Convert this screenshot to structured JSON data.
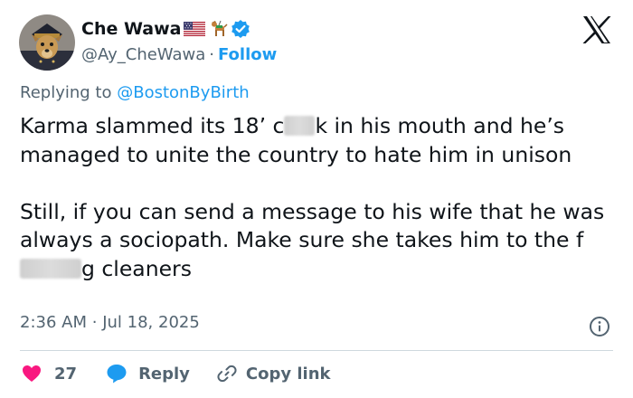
{
  "author": {
    "name": "Che Wawa",
    "handle": "@Ay_CheWawa",
    "separator": "·",
    "follow_label": "Follow",
    "emojis": [
      "us-flag-emoji",
      "guide-dog-emoji"
    ],
    "verified": true
  },
  "reply_context": {
    "prefix": "Replying to",
    "mention": "@BostonByBirth"
  },
  "tweet": {
    "paragraph1": {
      "part1": "Karma slammed its 18’ c",
      "part2": "k in his mouth and he’s managed to unite the country to hate him in unison"
    },
    "paragraph2": {
      "part1": "Still, if you can send a message to his wife that he was always a sociopath. Make sure she takes him to the f",
      "part2": "g cleaners"
    }
  },
  "timestamp": {
    "time": "2:36 AM",
    "separator": "·",
    "date": "Jul 18, 2025"
  },
  "actions": {
    "like_count": "27",
    "reply_label": "Reply",
    "copy_link_label": "Copy link"
  },
  "colors": {
    "link": "#1d9bf0",
    "like": "#f91880",
    "secondary_text": "#536471",
    "primary_text": "#0f1419"
  }
}
